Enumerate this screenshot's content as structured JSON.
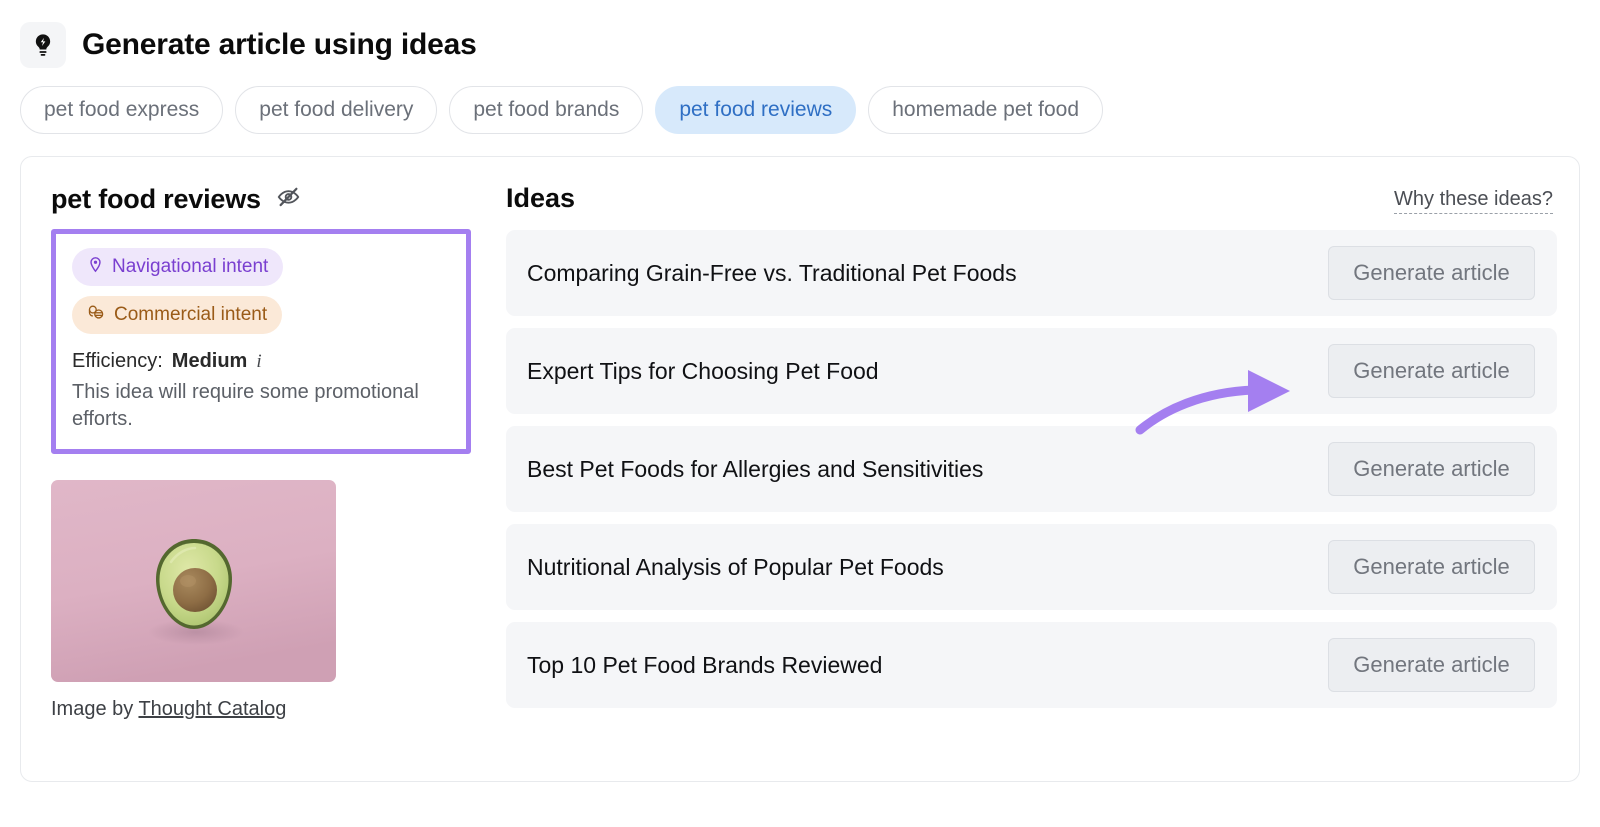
{
  "header": {
    "icon": "lightbulb-bolt-icon",
    "title": "Generate article using ideas"
  },
  "keyword_pills": [
    {
      "label": "pet food express",
      "selected": false
    },
    {
      "label": "pet food delivery",
      "selected": false
    },
    {
      "label": "pet food brands",
      "selected": false
    },
    {
      "label": "pet food reviews",
      "selected": true
    },
    {
      "label": "homemade pet food",
      "selected": false
    }
  ],
  "left_panel": {
    "keyword": "pet food reviews",
    "hide_icon": "eye-off-icon",
    "badges": [
      {
        "label": "Navigational intent",
        "icon": "map-pin-icon",
        "type": "navigational"
      },
      {
        "label": "Commercial intent",
        "icon": "coins-icon",
        "type": "commercial"
      }
    ],
    "efficiency_label": "Efficiency:",
    "efficiency_value": "Medium",
    "info_icon": "info-icon",
    "description": "This idea will require some promotional efforts.",
    "image_credit_prefix": "Image by",
    "image_credit_author": "Thought Catalog",
    "image_alt": "avocado-half-on-pink-background"
  },
  "ideas_panel": {
    "title": "Ideas",
    "why_link": "Why these ideas?",
    "items": [
      {
        "title": "Comparing Grain-Free vs. Traditional Pet Foods",
        "button": "Generate article"
      },
      {
        "title": "Expert Tips for Choosing Pet Food",
        "button": "Generate article"
      },
      {
        "title": "Best Pet Foods for Allergies and Sensitivities",
        "button": "Generate article"
      },
      {
        "title": "Nutritional Analysis of Popular Pet Foods",
        "button": "Generate article"
      },
      {
        "title": "Top 10 Pet Food Brands Reviewed",
        "button": "Generate article"
      }
    ]
  },
  "annotations": {
    "highlight_box_color": "#a47ff0",
    "arrow_color": "#a47ff0",
    "arrow_target_idea_index": 1
  },
  "colors": {
    "selected_pill_bg": "#d7e9fb",
    "selected_pill_text": "#2f6fc4",
    "navigational_badge_bg": "#efe7fb",
    "navigational_badge_text": "#7a3fd0",
    "commercial_badge_bg": "#fbe9d8",
    "commercial_badge_text": "#9a5b18",
    "idea_row_bg": "#f5f6f8",
    "button_bg": "#eceef1"
  }
}
